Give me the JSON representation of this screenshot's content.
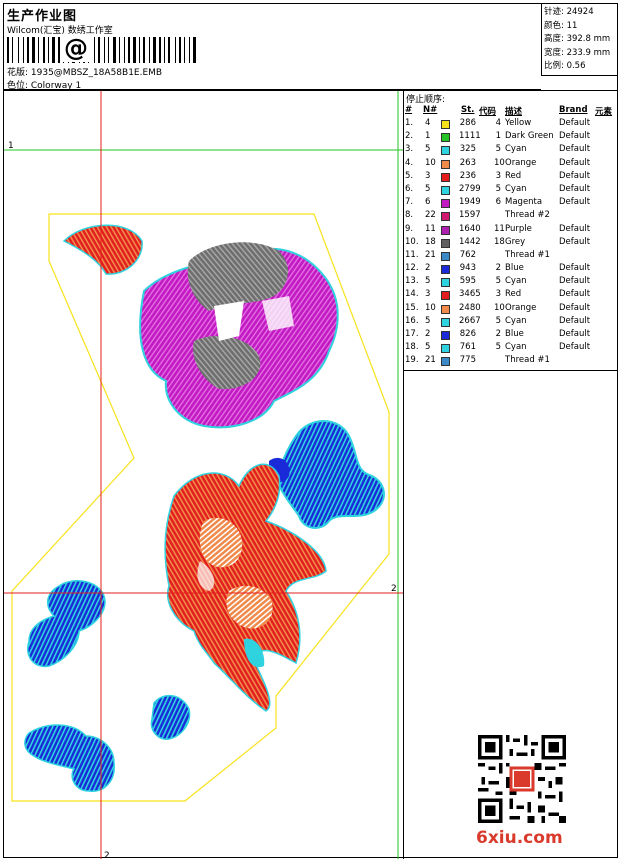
{
  "header": {
    "title": "生产作业图",
    "company": "Wilcom(汇宝) 数绣工作室",
    "pattern": "花版: 1935@MBSZ_18A58B1E.EMB",
    "colorway": "色位: Colorway 1"
  },
  "stats": {
    "stitches": "针迹: 24924",
    "colors": "颜色: 11",
    "height": "高度: 392.8 mm",
    "width": "宽度: 233.9 mm",
    "scale": "比例: 0.56"
  },
  "stop_sequence": {
    "label": "停止顺序:",
    "columns": [
      "#",
      "N#",
      "St.",
      "代码",
      "描述",
      "Brand",
      "元素"
    ],
    "rows": [
      {
        "num": "1.",
        "n": "4",
        "color": "#f7e21a",
        "st": "286",
        "code": "4",
        "desc": "Yellow",
        "brand": "Default"
      },
      {
        "num": "2.",
        "n": "1",
        "color": "#22c322",
        "st": "1111",
        "code": "1",
        "desc": "Dark Green",
        "brand": "Default"
      },
      {
        "num": "3.",
        "n": "5",
        "color": "#2fd3e0",
        "st": "325",
        "code": "5",
        "desc": "Cyan",
        "brand": "Default"
      },
      {
        "num": "4.",
        "n": "10",
        "color": "#f08a4b",
        "st": "263",
        "code": "10",
        "desc": "Orange",
        "brand": "Default"
      },
      {
        "num": "5.",
        "n": "3",
        "color": "#e31d1d",
        "st": "236",
        "code": "3",
        "desc": "Red",
        "brand": "Default"
      },
      {
        "num": "6.",
        "n": "5",
        "color": "#2fd3e0",
        "st": "2799",
        "code": "5",
        "desc": "Cyan",
        "brand": "Default"
      },
      {
        "num": "7.",
        "n": "6",
        "color": "#c21ac2",
        "st": "1949",
        "code": "6",
        "desc": "Magenta",
        "brand": "Default"
      },
      {
        "num": "8.",
        "n": "22",
        "color": "#d01870",
        "st": "1597",
        "code": "",
        "desc": "Thread #2",
        "brand": ""
      },
      {
        "num": "9.",
        "n": "11",
        "color": "#b020b0",
        "st": "1640",
        "code": "11",
        "desc": "Purple",
        "brand": "Default"
      },
      {
        "num": "10.",
        "n": "18",
        "color": "#606060",
        "st": "1442",
        "code": "18",
        "desc": "Grey",
        "brand": "Default"
      },
      {
        "num": "11.",
        "n": "21",
        "color": "#3a8ac8",
        "st": "762",
        "code": "",
        "desc": "Thread #1",
        "brand": ""
      },
      {
        "num": "12.",
        "n": "2",
        "color": "#1a2ad8",
        "st": "943",
        "code": "2",
        "desc": "Blue",
        "brand": "Default"
      },
      {
        "num": "13.",
        "n": "5",
        "color": "#2fd3e0",
        "st": "595",
        "code": "5",
        "desc": "Cyan",
        "brand": "Default"
      },
      {
        "num": "14.",
        "n": "3",
        "color": "#e31d1d",
        "st": "3465",
        "code": "3",
        "desc": "Red",
        "brand": "Default"
      },
      {
        "num": "15.",
        "n": "10",
        "color": "#f08a4b",
        "st": "2480",
        "code": "10",
        "desc": "Orange",
        "brand": "Default"
      },
      {
        "num": "16.",
        "n": "5",
        "color": "#2fd3e0",
        "st": "2667",
        "code": "5",
        "desc": "Cyan",
        "brand": "Default"
      },
      {
        "num": "17.",
        "n": "2",
        "color": "#1a2ad8",
        "st": "826",
        "code": "2",
        "desc": "Blue",
        "brand": "Default"
      },
      {
        "num": "18.",
        "n": "5",
        "color": "#2fd3e0",
        "st": "761",
        "code": "5",
        "desc": "Cyan",
        "brand": "Default"
      },
      {
        "num": "19.",
        "n": "21",
        "color": "#3a8ac8",
        "st": "775",
        "code": "",
        "desc": "Thread #1",
        "brand": ""
      }
    ]
  },
  "guides": {
    "green_label": "1",
    "red_label": "2",
    "red_label_bottom": "2"
  },
  "watermark": "6xiu.com"
}
